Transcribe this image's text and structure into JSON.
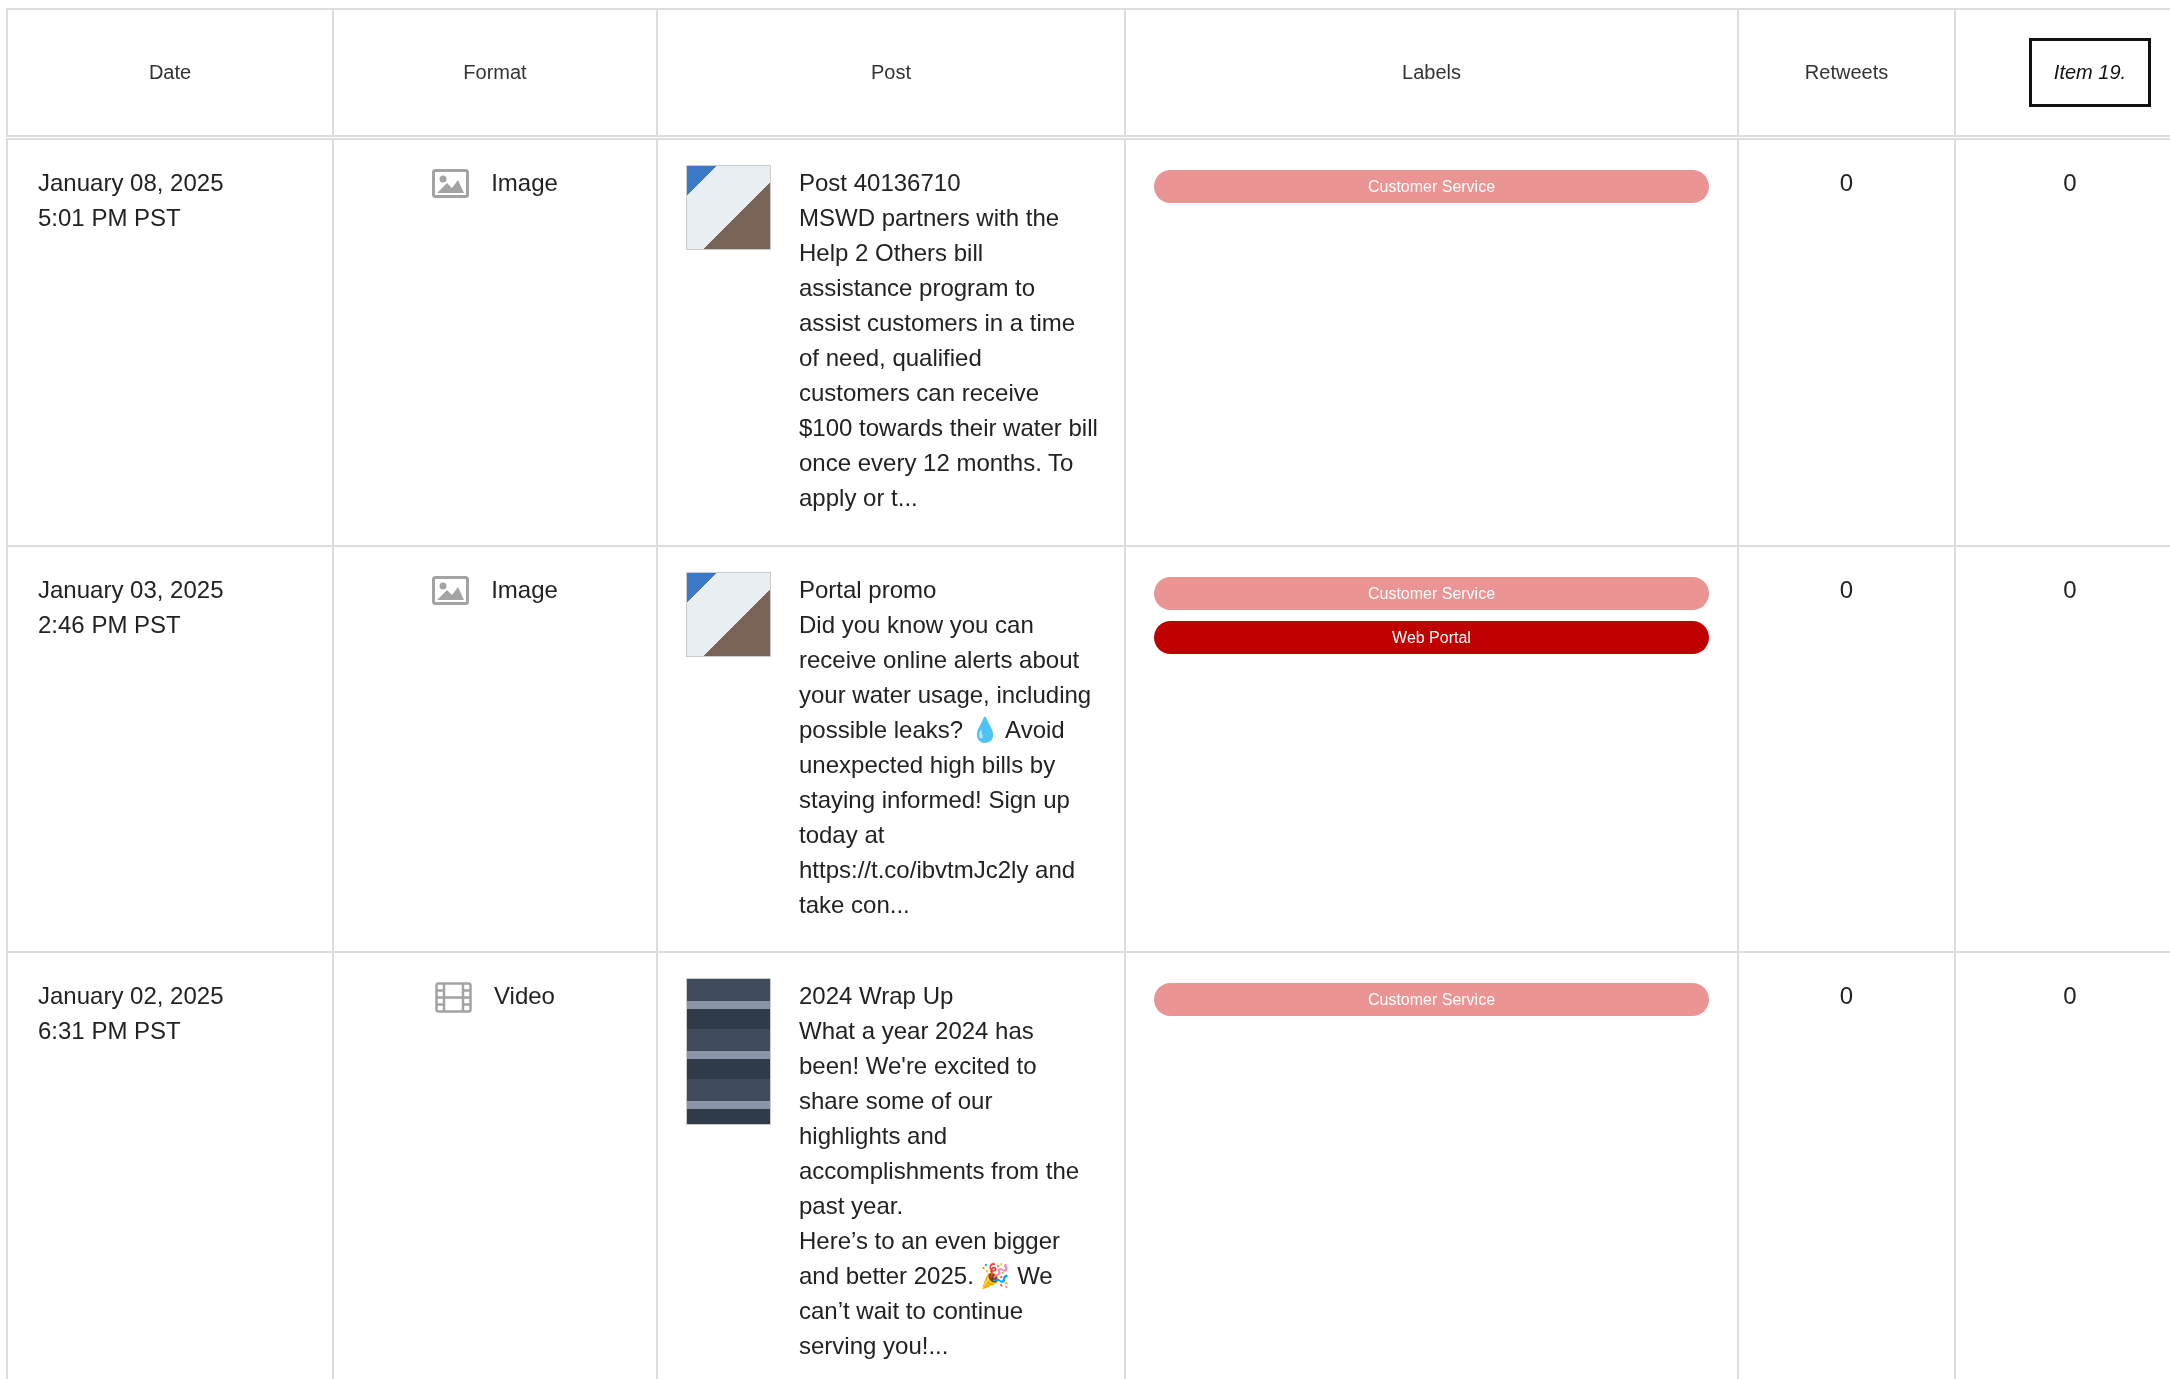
{
  "table": {
    "columns": [
      {
        "label": "Date"
      },
      {
        "label": "Format"
      },
      {
        "label": "Post"
      },
      {
        "label": "Labels"
      },
      {
        "label": "Retweets"
      },
      {
        "label": "Item 19.",
        "kind": "boxed"
      }
    ],
    "rows": [
      {
        "date": "January 08, 2025",
        "time": "5:01 PM PST",
        "format": {
          "kind": "image",
          "label": "Image"
        },
        "post": {
          "title": "Post 40136710",
          "body": "MSWD partners with the Help 2 Others bill assistance program to assist customers in a time of need, qualified customers can receive $100 towards their water bill once every 12 months. To apply or t..."
        },
        "labels": [
          {
            "text": "Customer Service",
            "color": "#ea9494"
          }
        ],
        "retweets": "0",
        "column_6": "0"
      },
      {
        "date": "January 03, 2025",
        "time": "2:46 PM PST",
        "format": {
          "kind": "image",
          "label": "Image"
        },
        "post": {
          "title": "Portal promo",
          "body": "Did you know you can receive online alerts about your water usage, including possible leaks? 💧 Avoid unexpected high bills by staying informed! Sign up today at https://t.co/ibvtmJc2ly and take con..."
        },
        "labels": [
          {
            "text": "Customer Service",
            "color": "#ea9494"
          },
          {
            "text": "Web Portal",
            "color": "#c00000"
          }
        ],
        "retweets": "0",
        "column_6": "0"
      },
      {
        "date": "January 02, 2025",
        "time": "6:31 PM PST",
        "format": {
          "kind": "video",
          "label": "Video"
        },
        "post": {
          "title": "2024 Wrap Up",
          "body": "What a year 2024 has been! We're excited to share some of our highlights and accomplishments from the past year.\nHere’s to an even bigger and better 2025. 🎉 We can’t wait to continue serving you!..."
        },
        "labels": [
          {
            "text": "Customer Service",
            "color": "#ea9494"
          }
        ],
        "retweets": "0",
        "column_6": "0"
      }
    ]
  }
}
